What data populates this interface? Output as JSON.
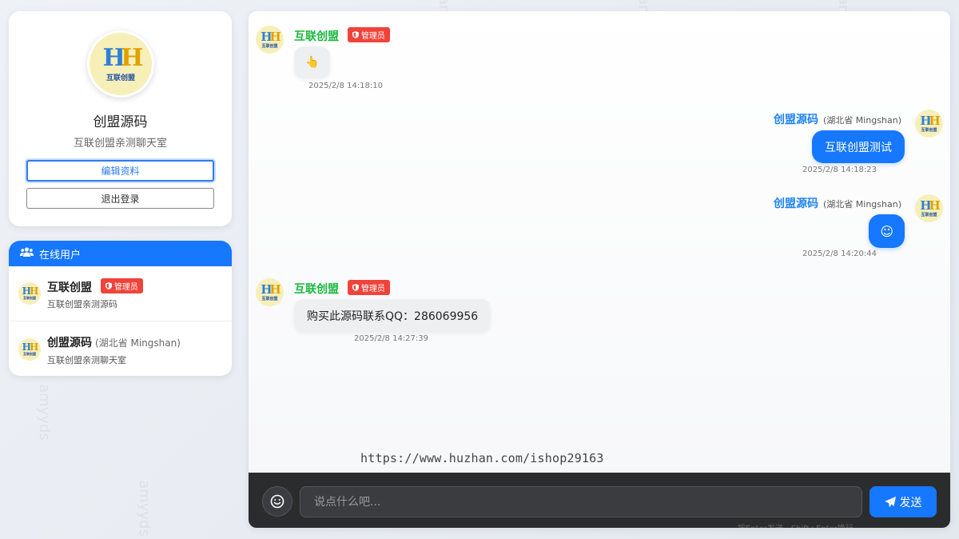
{
  "profile": {
    "avatar_logo": "互联创盟",
    "name": "创盟源码",
    "signature": "互联创盟亲测聊天室",
    "edit_label": "编辑资料",
    "logout_label": "退出登录"
  },
  "online": {
    "title": "在线用户",
    "users": [
      {
        "name": "互联创盟",
        "badge": "管理员",
        "signature": "互联创盟亲测源码"
      },
      {
        "name": "创盟源码",
        "location": "(湖北省 Mingshan)",
        "signature": "互联创盟亲测聊天室"
      }
    ]
  },
  "messages": [
    {
      "sender": "互联创盟",
      "badge": "管理员",
      "content": "👆",
      "time": "2025/2/8 14:18:10",
      "side": "left"
    },
    {
      "sender": "创盟源码",
      "location": "(湖北省 Mingshan)",
      "content": "互联创盟测试",
      "time": "2025/2/8 14:18:23",
      "side": "right"
    },
    {
      "sender": "创盟源码",
      "location": "(湖北省 Mingshan)",
      "content": "☺",
      "time": "2025/2/8 14:20:44",
      "side": "right"
    },
    {
      "sender": "互联创盟",
      "badge": "管理员",
      "content": "购买此源码联系QQ：286069956",
      "time": "2025/2/8 14:27:39",
      "side": "left"
    }
  ],
  "watermark": {
    "text": "amyyds",
    "url": "https://www.huzhan.com/ishop29163"
  },
  "composer": {
    "placeholder": "说点什么吧...",
    "send_label": "发送",
    "hint": "按Enter发送，Shift+Enter换行"
  },
  "colors": {
    "accent": "#1677ff",
    "admin_badge": "#f0433a",
    "admin_name": "#18b83c",
    "user_name": "#1f84f0"
  },
  "icons": [
    "users-icon",
    "shield-icon",
    "emoji-icon",
    "send-icon"
  ]
}
